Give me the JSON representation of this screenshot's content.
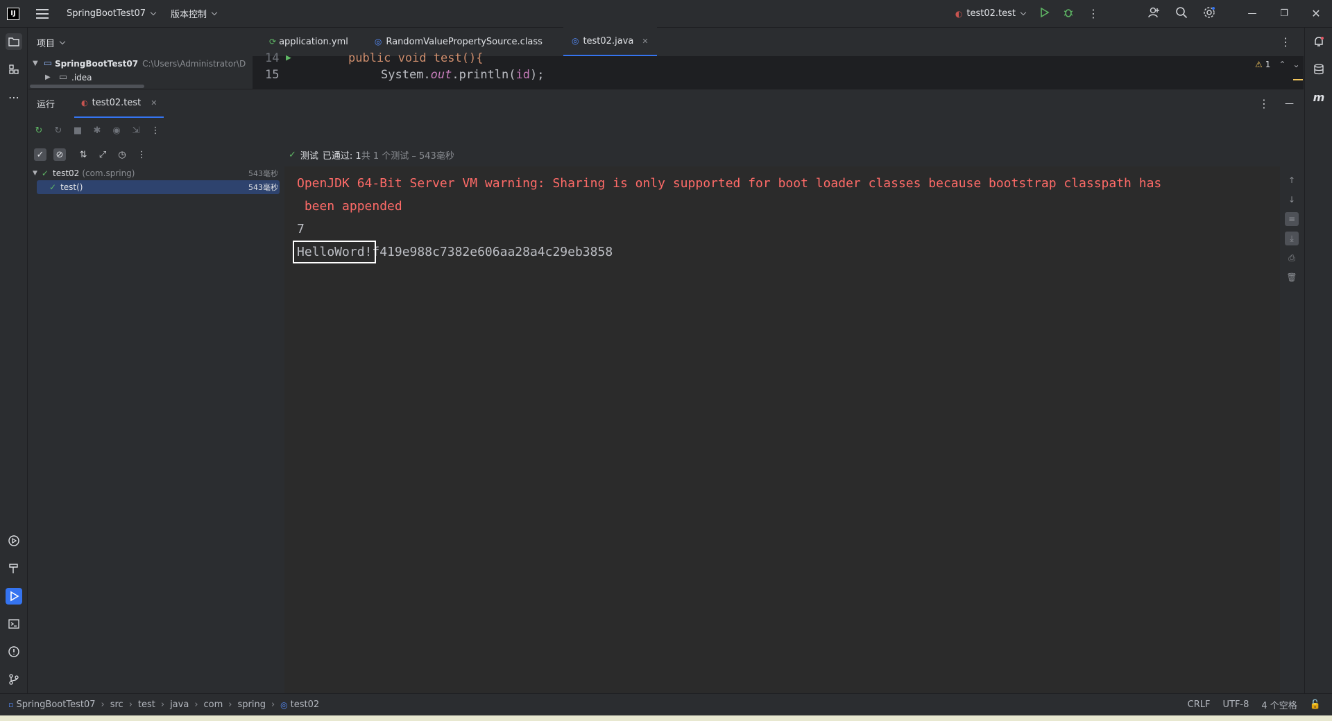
{
  "titlebar": {
    "project": "SpringBootTest07",
    "vcs": "版本控制",
    "run_config": "test02.test"
  },
  "project_panel": {
    "title": "项目",
    "root": "SpringBootTest07",
    "root_path": "C:\\Users\\Administrator\\D",
    "child": ".idea"
  },
  "editor": {
    "tabs": [
      {
        "label": "application.yml"
      },
      {
        "label": "RandomValuePropertySource.class"
      },
      {
        "label": "test02.java"
      }
    ],
    "lines": [
      {
        "num": "14",
        "code": "public void test(){"
      },
      {
        "num": "15",
        "code_prefix": "System.",
        "code_field": "out",
        "code_suffix": ".println(",
        "code_arg": "id",
        "code_end": ");"
      }
    ],
    "warning_count": "1"
  },
  "run_panel": {
    "tab_run": "运行",
    "tab_test": "test02.test"
  },
  "test_tree": [
    {
      "label": "test02",
      "pkg": "(com.spring)",
      "time": "543毫秒"
    },
    {
      "label": "test()",
      "time": "543毫秒"
    }
  ],
  "test_status": {
    "prefix": "测试",
    "passed": "已通过: 1",
    "suffix": "共 1 个测试 – 543毫秒"
  },
  "console": {
    "warning_line1": "OpenJDK 64-Bit Server VM warning: Sharing is only supported for boot loader classes because bootstrap classpath has",
    "warning_line2": " been appended",
    "line3": "7",
    "line4_boxed": "HelloWord!",
    "line4_rest": "f419e988c7382e606aa28a4c29eb3858"
  },
  "statusbar": {
    "breadcrumbs": [
      "SpringBootTest07",
      "src",
      "test",
      "java",
      "com",
      "spring",
      "test02"
    ],
    "line_sep": "CRLF",
    "encoding": "UTF-8",
    "indent": "4 个空格"
  },
  "colors": {
    "accent": "#3574f0",
    "warning_text": "#ff6b68",
    "pass": "#5fb865"
  }
}
